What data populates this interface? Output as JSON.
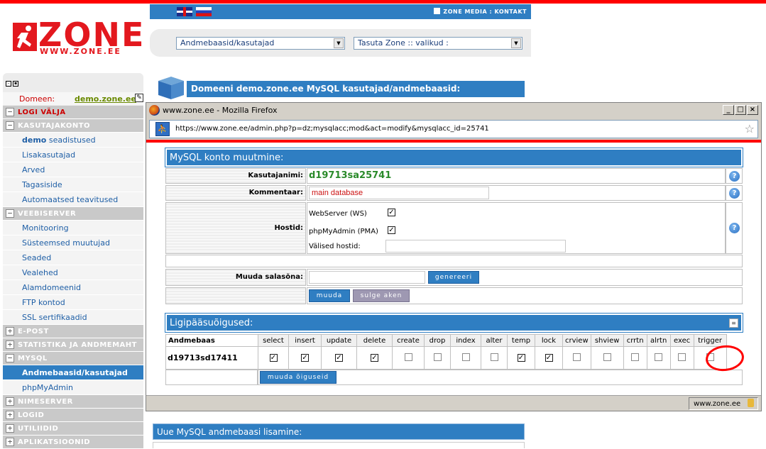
{
  "brand": {
    "logo_text": "ZONE",
    "logo_url": "WWW.ZONE.EE",
    "logo_color": "#e3181e",
    "accent": "#2f7ec2"
  },
  "topbar": {
    "links": "ZONE MEDIA : KONTAKT"
  },
  "selects": {
    "left": "Andmebaasid/kasutajad",
    "right": "Tasuta Zone :: valikud :"
  },
  "domain_header": "Domeeni demo.zone.ee MySQL kasutajad/andmebaasid:",
  "sidebar": {
    "domain_label": "Domeen:",
    "domain_value": "demo.zone.ee",
    "logout": "LOGI VÄLJA",
    "sections": [
      {
        "title": "KASUTAJAKONTO",
        "items": [
          {
            "bold": "demo",
            "label": " seadistused"
          },
          {
            "label": "Lisakasutajad"
          },
          {
            "label": "Arved"
          },
          {
            "label": "Tagasiside"
          },
          {
            "label": "Automaatsed teavitused"
          }
        ]
      },
      {
        "title": "VEEBISERVER",
        "items": [
          {
            "label": "Monitooring"
          },
          {
            "label": "Süsteemsed muutujad"
          },
          {
            "label": "Seaded"
          },
          {
            "label": "Vealehed"
          },
          {
            "label": "Alamdomeenid"
          },
          {
            "label": "FTP kontod"
          },
          {
            "label": "SSL sertifikaadid"
          }
        ]
      },
      {
        "title": "E-POST"
      },
      {
        "title": "STATISTIKA JA ANDMEMAHT"
      },
      {
        "title": "MYSQL",
        "items": [
          {
            "label": "Andmebaasid/kasutajad",
            "active": true
          },
          {
            "label": "phpMyAdmin"
          }
        ]
      },
      {
        "title": "NIMESERVER"
      },
      {
        "title": "LOGID"
      },
      {
        "title": "UTILIIDID"
      },
      {
        "title": "APLIKATSIOONID"
      }
    ]
  },
  "popup": {
    "title": "www.zone.ee - Mozilla Firefox",
    "url": "https://www.zone.ee/admin.php?p=dz;mysqlacc;mod&act=modify&mysqlacc_id=25741",
    "status_host": "www.zone.ee",
    "form": {
      "heading": "MySQL konto muutmine:",
      "username_label": "Kasutajanimi:",
      "username_value": "d19713sa25741",
      "comment_label": "Kommentaar:",
      "comment_value": "main database",
      "hosts_label": "Hostid:",
      "host_ws": "WebServer (WS)",
      "host_pma": "phpMyAdmin (PMA)",
      "external_hosts_label": "Välised hostid:",
      "external_hosts_value": "",
      "password_label": "Muuda salasõna:",
      "password_value": "",
      "generate_button": "genereeri",
      "modify_button": "muuda",
      "close_button": "sulge aken"
    },
    "privileges": {
      "heading": "Ligipääsuõigused:",
      "db_column": "Andmebaas",
      "columns": [
        "select",
        "insert",
        "update",
        "delete",
        "create",
        "drop",
        "index",
        "alter",
        "temp",
        "lock",
        "crview",
        "shview",
        "crrtn",
        "alrtn",
        "exec",
        "trigger"
      ],
      "rows": [
        {
          "db": "d19713sd17411",
          "checked": [
            true,
            true,
            true,
            true,
            false,
            false,
            false,
            false,
            true,
            true,
            false,
            false,
            false,
            false,
            false,
            false
          ]
        }
      ],
      "modify_button": "muuda õiguseid"
    }
  },
  "bottom_section": "Uue MySQL andmebaasi lisamine:"
}
